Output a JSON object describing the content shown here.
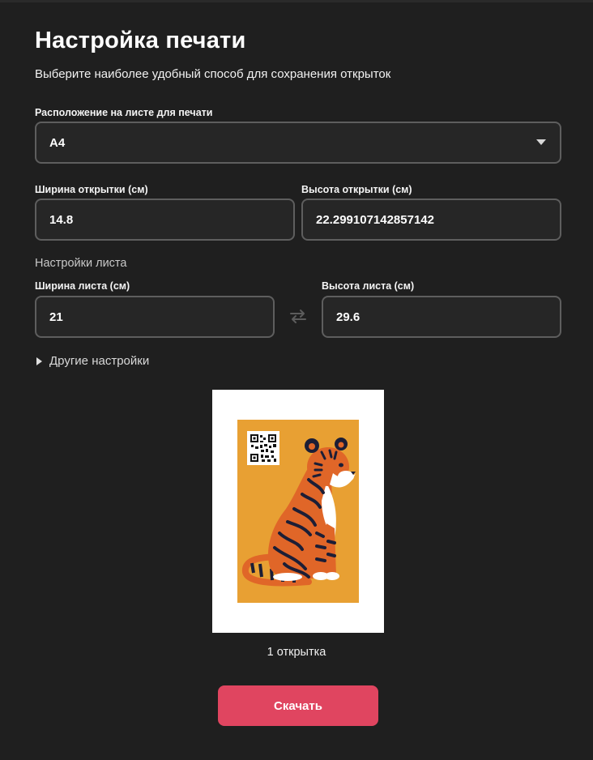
{
  "header": {
    "title": "Настройка печати",
    "subtitle": "Выберите наиболее удобный способ для сохранения открыток"
  },
  "layout_select": {
    "label": "Расположение на листе для печати",
    "value": "A4",
    "icon": "caret-down-icon"
  },
  "card_size": {
    "width_label": "Ширина открытки (см)",
    "width_value": "14.8",
    "height_label": "Высота открытки (см)",
    "height_value": "22.299107142857142"
  },
  "sheet_settings": {
    "section_label": "Настройки листа",
    "width_label": "Ширина листа (см)",
    "width_value": "21",
    "height_label": "Высота листа (см)",
    "height_value": "29.6",
    "swap_icon": "swap-arrows-icon"
  },
  "other_settings": {
    "label": "Другие настройки",
    "icon": "triangle-right-icon"
  },
  "preview": {
    "count_label": "1 открытка",
    "card_background": "#e8a033",
    "illustration": "tiger-illustration",
    "qr": "qr-code"
  },
  "actions": {
    "download_label": "Скачать",
    "accent": "#e04560"
  }
}
